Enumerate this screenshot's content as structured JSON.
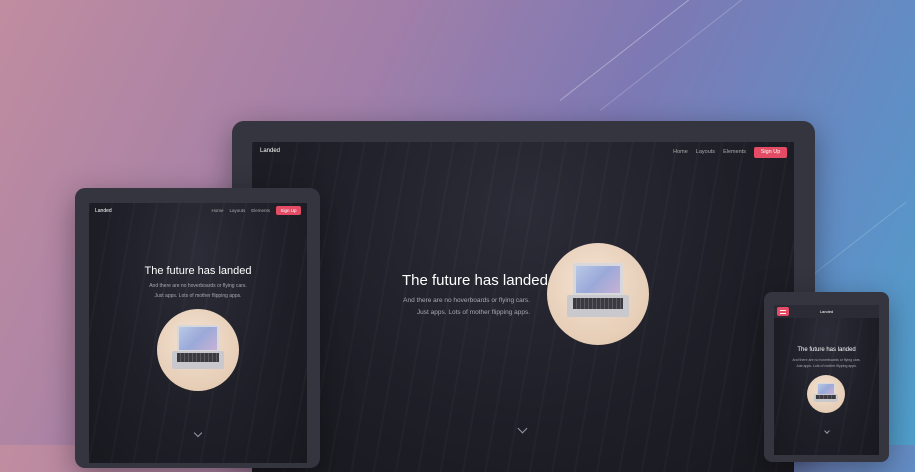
{
  "desktop": {
    "brand": "Landed",
    "nav": [
      "Home",
      "Layouts",
      "Elements"
    ],
    "signup": "Sign Up",
    "title": "The future has landed",
    "subtitle_line1": "And there are no hoverboards or flying cars.",
    "subtitle_line2": "Just apps. Lots of mother flipping apps."
  },
  "tablet": {
    "brand": "Landed",
    "nav": [
      "Home",
      "Layouts",
      "Elements"
    ],
    "signup": "Sign Up",
    "title": "The future has landed",
    "subtitle_line1": "And there are no hoverboards or flying cars.",
    "subtitle_line2": "Just apps. Lots of mother flipping apps."
  },
  "phone": {
    "brand": "Landed",
    "menu_icon": "hamburger-icon",
    "title": "The future has landed",
    "subtitle_line1": "And there are no hoverboards or flying cars.",
    "subtitle_line2": "Just apps. Lots of mother flipping apps."
  },
  "colors": {
    "accent": "#e44c65",
    "device_frame": "#34353f",
    "screen_bg": "#1f1f28"
  }
}
